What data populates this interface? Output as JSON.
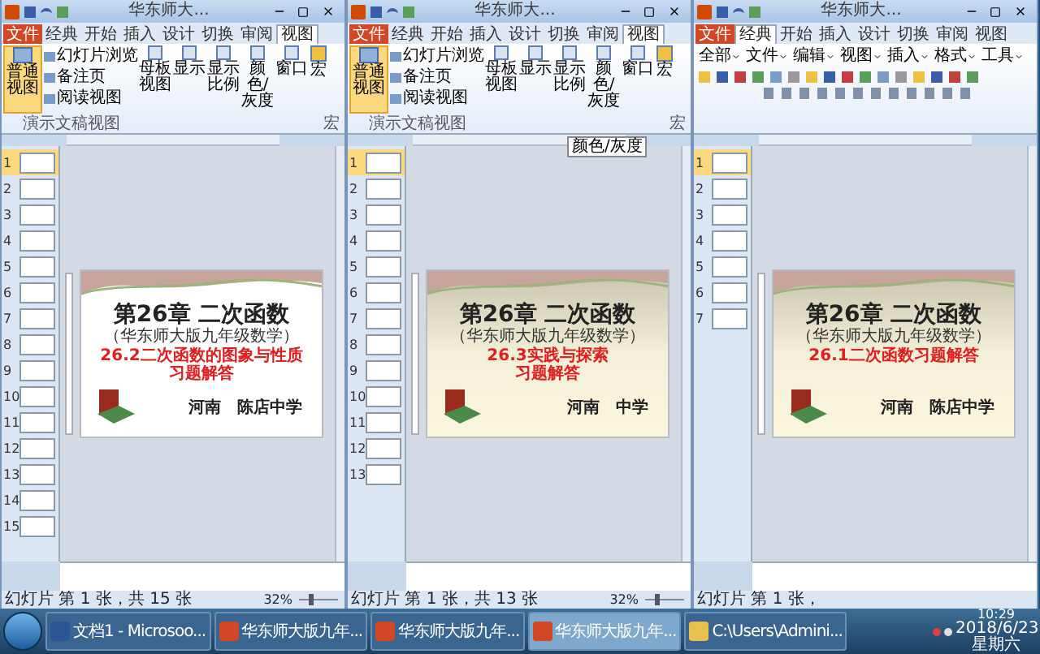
{
  "windows": [
    {
      "title": "华东师大...",
      "tabs": [
        {
          "label": "文件",
          "kind": "file",
          "selected": false
        },
        {
          "label": "经典",
          "kind": "tab",
          "selected": false
        },
        {
          "label": "开始",
          "kind": "tab",
          "selected": false
        },
        {
          "label": "插入",
          "kind": "tab",
          "selected": false
        },
        {
          "label": "设计",
          "kind": "tab",
          "selected": false
        },
        {
          "label": "切换",
          "kind": "tab",
          "selected": false
        },
        {
          "label": "审阅",
          "kind": "tab",
          "selected": false
        },
        {
          "label": "视图",
          "kind": "tab",
          "selected": true
        }
      ],
      "ribbon": {
        "kind": "view",
        "main_button": {
          "label": "普通视图",
          "selected": true
        },
        "small_buttons": [
          "幻灯片浏览",
          "备注页",
          "阅读视图"
        ],
        "buttons": [
          "母板视图",
          "显示",
          "显示比例",
          "颜色/灰度",
          "窗口"
        ],
        "macro": "宏",
        "group_labels": [
          "演示文稿视图",
          "宏"
        ]
      },
      "thumbnails": [
        {
          "number": "1",
          "selected": true
        },
        {
          "number": "2",
          "selected": false
        },
        {
          "number": "3",
          "selected": false
        },
        {
          "number": "4",
          "selected": false
        },
        {
          "number": "5",
          "selected": false
        },
        {
          "number": "6",
          "selected": false
        },
        {
          "number": "7",
          "selected": false
        },
        {
          "number": "8",
          "selected": false
        },
        {
          "number": "9",
          "selected": false
        },
        {
          "number": "10",
          "selected": false
        },
        {
          "number": "11",
          "selected": false
        },
        {
          "number": "12",
          "selected": false
        },
        {
          "number": "13",
          "selected": false
        },
        {
          "number": "14",
          "selected": false
        },
        {
          "number": "15",
          "selected": false
        }
      ],
      "slide": {
        "tinted": false,
        "title": "第26章 二次函数",
        "subtitle": "（华东师大版九年级数学）",
        "red_lines": [
          "26.2二次函数的图象与性质",
          "习题解答"
        ],
        "footer": [
          "河南",
          "陈店中学"
        ]
      },
      "status": {
        "text": "幻灯片 第 1 张，共 15 张",
        "zoom": "32%",
        "level": 0.3
      }
    },
    {
      "title": "华东师大...",
      "tabs": [
        {
          "label": "文件",
          "kind": "file",
          "selected": false
        },
        {
          "label": "经典",
          "kind": "tab",
          "selected": false
        },
        {
          "label": "开始",
          "kind": "tab",
          "selected": false
        },
        {
          "label": "插入",
          "kind": "tab",
          "selected": false
        },
        {
          "label": "设计",
          "kind": "tab",
          "selected": false
        },
        {
          "label": "切换",
          "kind": "tab",
          "selected": false
        },
        {
          "label": "审阅",
          "kind": "tab",
          "selected": false
        },
        {
          "label": "视图",
          "kind": "tab",
          "selected": true
        }
      ],
      "ribbon": {
        "kind": "view",
        "main_button": {
          "label": "普通视图",
          "selected": true
        },
        "small_buttons": [
          "幻灯片浏览",
          "备注页",
          "阅读视图"
        ],
        "buttons": [
          "母板视图",
          "显示",
          "显示比例",
          "颜色/灰度",
          "窗口"
        ],
        "macro": "宏",
        "group_labels": [
          "演示文稿视图",
          "宏"
        ]
      },
      "tooltip": "颜色/灰度",
      "thumbnails": [
        {
          "number": "1",
          "selected": true
        },
        {
          "number": "2",
          "selected": false
        },
        {
          "number": "3",
          "selected": false
        },
        {
          "number": "4",
          "selected": false
        },
        {
          "number": "5",
          "selected": false
        },
        {
          "number": "6",
          "selected": false
        },
        {
          "number": "7",
          "selected": false
        },
        {
          "number": "8",
          "selected": false
        },
        {
          "number": "9",
          "selected": false
        },
        {
          "number": "10",
          "selected": false
        },
        {
          "number": "11",
          "selected": false
        },
        {
          "number": "12",
          "selected": false
        },
        {
          "number": "13",
          "selected": false
        }
      ],
      "slide": {
        "tinted": true,
        "title": "第26章 二次函数",
        "subtitle": "（华东师大版九年级数学）",
        "red_lines": [
          "26.3实践与探索",
          "习题解答"
        ],
        "footer": [
          "河南",
          "中学"
        ]
      },
      "status": {
        "text": "幻灯片 第 1 张，共 13 张",
        "zoom": "32%",
        "level": 0.3
      }
    },
    {
      "title": "华东师大...",
      "tabs": [
        {
          "label": "文件",
          "kind": "file",
          "selected": false
        },
        {
          "label": "经典",
          "kind": "tab",
          "selected": true
        },
        {
          "label": "开始",
          "kind": "tab",
          "selected": false
        },
        {
          "label": "插入",
          "kind": "tab",
          "selected": false
        },
        {
          "label": "设计",
          "kind": "tab",
          "selected": false
        },
        {
          "label": "切换",
          "kind": "tab",
          "selected": false
        },
        {
          "label": "审阅",
          "kind": "tab",
          "selected": false
        },
        {
          "label": "视图",
          "kind": "tab",
          "selected": false
        }
      ],
      "ribbon": {
        "kind": "classic",
        "menus": [
          "全部",
          "文件",
          "编辑",
          "视图",
          "插入",
          "格式",
          "工具"
        ]
      },
      "thumbnails": [
        {
          "number": "1",
          "selected": true
        },
        {
          "number": "2",
          "selected": false
        },
        {
          "number": "3",
          "selected": false
        },
        {
          "number": "4",
          "selected": false
        },
        {
          "number": "5",
          "selected": false
        },
        {
          "number": "6",
          "selected": false
        },
        {
          "number": "7",
          "selected": false
        }
      ],
      "slide": {
        "tinted": true,
        "title": "第26章 二次函数",
        "subtitle": "（华东师大版九年级数学）",
        "red_lines": [
          "26.1二次函数习题解答"
        ],
        "footer": [
          "河南",
          "陈店中学"
        ]
      },
      "status": {
        "text": "幻灯片 第 1 张，"
      }
    }
  ],
  "taskbar": {
    "items": [
      {
        "kind": "word",
        "label": "文档1 - Microsoo...",
        "selected": false
      },
      {
        "kind": "ppt",
        "label": "华东师大版九年...",
        "selected": false
      },
      {
        "kind": "ppt",
        "label": "华东师大版九年...",
        "selected": false
      },
      {
        "kind": "ppt",
        "label": "华东师大版九年...",
        "selected": true
      },
      {
        "kind": "folder",
        "label": "C:\\Users\\Admini...",
        "selected": false
      }
    ],
    "time": "10:29",
    "date": "2018/6/23 星期六"
  }
}
